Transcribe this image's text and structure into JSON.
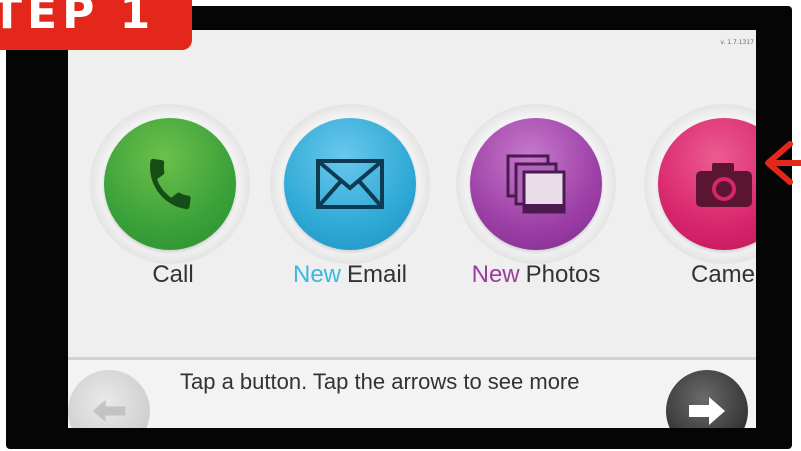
{
  "step_badge": {
    "text": "TEP 1",
    "color": "#e3281b"
  },
  "version": "v. 1.7.1317",
  "apps": [
    {
      "prefix": "",
      "label": "Call",
      "icon": "phone-icon",
      "color": "#3aa13a",
      "prefix_color": ""
    },
    {
      "prefix": "New",
      "label": "Email",
      "icon": "envelope-icon",
      "color": "#2ea9d6",
      "prefix_color": "#3db7e0"
    },
    {
      "prefix": "New",
      "label": "Photos",
      "icon": "photos-icon",
      "color": "#9c3fa6",
      "prefix_color": "#9b3d9e"
    },
    {
      "prefix": "",
      "label": "Camer",
      "icon": "camera-icon",
      "color": "#d7256b",
      "prefix_color": ""
    }
  ],
  "navigation": {
    "hint": "Tap a button. Tap the arrows to see more",
    "left_icon": "left-arrow-icon",
    "right_icon": "right-arrow-icon"
  },
  "annotation": {
    "icon": "red-arrow-icon",
    "color": "#e3281b"
  }
}
